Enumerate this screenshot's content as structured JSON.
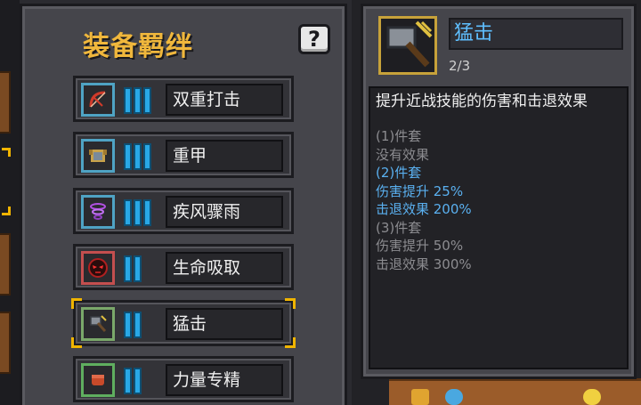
{
  "panel": {
    "title": "装备羁绊",
    "help_label": "?"
  },
  "bonds": [
    {
      "name": "双重打击",
      "icon": "bow-icon",
      "frame": "blue",
      "level": 3,
      "selected": false
    },
    {
      "name": "重甲",
      "icon": "armor-icon",
      "frame": "blue",
      "level": 3,
      "selected": false
    },
    {
      "name": "疾风骤雨",
      "icon": "whirlwind-icon",
      "frame": "blue",
      "level": 3,
      "selected": false
    },
    {
      "name": "生命吸取",
      "icon": "red-demon-icon",
      "frame": "green",
      "level": 2,
      "selected": false
    },
    {
      "name": "猛击",
      "icon": "hammer-icon",
      "frame": "gray",
      "level": 2,
      "selected": true
    },
    {
      "name": "力量专精",
      "icon": "fist-icon",
      "frame": "green",
      "level": 2,
      "selected": false
    }
  ],
  "detail": {
    "title": "猛击",
    "count": "2/3",
    "icon": "hammer-icon",
    "description": "提升近战技能的伤害和击退效果",
    "tiers": [
      {
        "header": "(1)件套",
        "lines": [
          "没有效果"
        ],
        "active": false
      },
      {
        "header": "(2)件套",
        "lines": [
          "伤害提升 25%",
          "击退效果 200%"
        ],
        "active": true
      },
      {
        "header": "(3)件套",
        "lines": [
          "伤害提升 50%",
          "击退效果 300%"
        ],
        "active": false
      }
    ]
  },
  "colors": {
    "title_gold": "#f0b73c",
    "active_blue": "#5ab0f0",
    "inactive_gray": "#8c8c90",
    "selection_yellow": "#f0b400"
  }
}
